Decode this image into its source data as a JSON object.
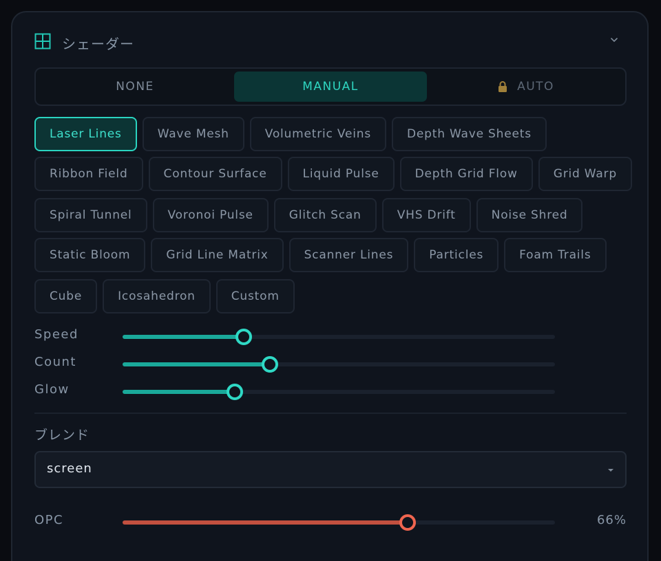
{
  "header": {
    "title": "シェーダー",
    "icon": "grid-icon",
    "chevron_icon": "chevron-down-icon"
  },
  "mode_tabs": [
    {
      "label": "NONE",
      "state": "default"
    },
    {
      "label": "MANUAL",
      "state": "active"
    },
    {
      "label": "AUTO",
      "state": "locked",
      "icon": "lock-icon"
    }
  ],
  "presets": {
    "rows": [
      [
        "Laser Lines",
        "Wave Mesh",
        "Volumetric Veins",
        "Depth Wave Sheets"
      ],
      [
        "Ribbon Field",
        "Contour Surface",
        "Liquid Pulse",
        "Depth Grid Flow",
        "Grid Warp"
      ],
      [
        "Spiral Tunnel",
        "Voronoi Pulse",
        "Glitch Scan",
        "VHS Drift",
        "Noise Shred"
      ],
      [
        "Static Bloom",
        "Grid Line Matrix",
        "Scanner Lines",
        "Particles",
        "Foam Trails"
      ],
      [
        "Cube",
        "Icosahedron",
        "Custom"
      ]
    ],
    "selected": "Laser Lines"
  },
  "sliders": [
    {
      "label": "Speed",
      "value": 0.28
    },
    {
      "label": "Count",
      "value": 0.34
    },
    {
      "label": "Glow",
      "value": 0.26
    }
  ],
  "blend": {
    "label": "ブレンド",
    "value": "screen"
  },
  "opacity": {
    "label": "OPC",
    "value": 0.66,
    "value_text": "66%"
  },
  "colors": {
    "accent": "#2fd6c1",
    "opacity_accent": "#f0654f",
    "lock": "#a0803a",
    "panel_bg": "#0f141d"
  }
}
